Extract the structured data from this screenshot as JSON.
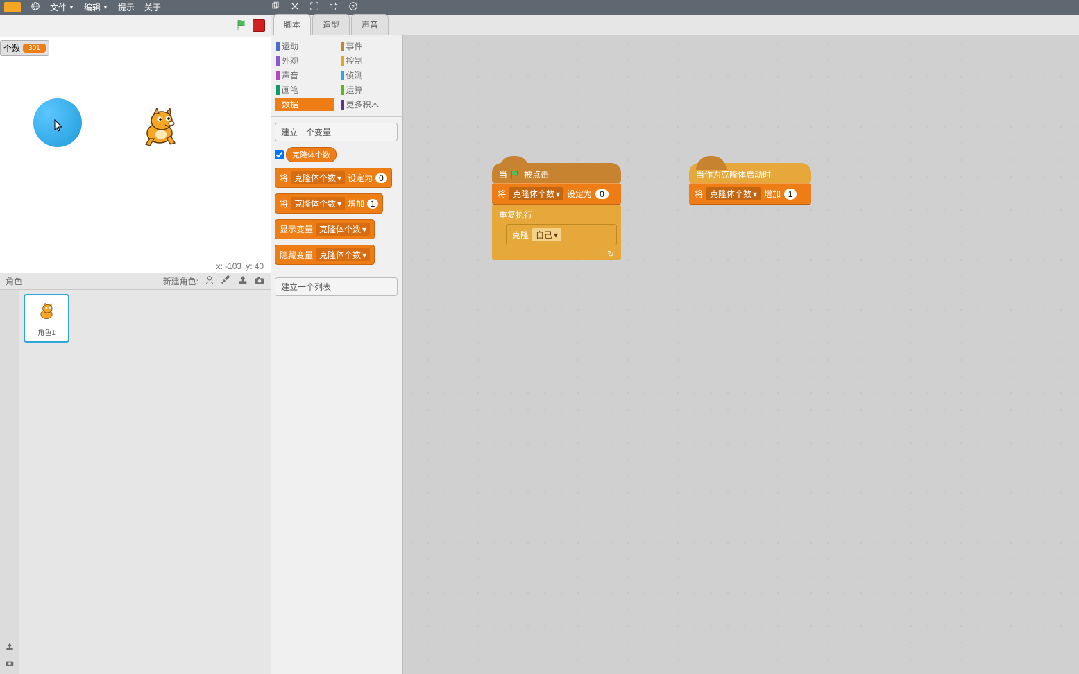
{
  "menu": {
    "file": "文件",
    "edit": "编辑",
    "tips": "提示",
    "about": "关于"
  },
  "stage": {
    "var_name": "个数",
    "var_value": "301",
    "x_label": "x:",
    "x": "-103",
    "y_label": "y:",
    "y": "40"
  },
  "sprites": {
    "section": "角色",
    "new_label": "新建角色:",
    "sprite1": "角色1"
  },
  "tabs": {
    "scripts": "脚本",
    "costumes": "造型",
    "sounds": "声音"
  },
  "categories": {
    "motion": "运动",
    "looks": "外观",
    "sound": "声音",
    "pen": "画笔",
    "data": "数据",
    "events": "事件",
    "control": "控制",
    "sensing": "侦测",
    "operators": "运算",
    "more": "更多积木"
  },
  "palette": {
    "make_var": "建立一个变量",
    "var_name": "克隆体个数",
    "set_pre": "将",
    "set_post": "设定为",
    "set_val": "0",
    "change_pre": "将",
    "change_post": "增加",
    "change_val": "1",
    "show": "显示变量",
    "hide": "隐藏变量",
    "make_list": "建立一个列表"
  },
  "scripts": {
    "when_clicked_pre": "当",
    "when_clicked_post": "被点击",
    "set_pre": "将",
    "set_var": "克隆体个数",
    "set_post": "设定为",
    "set_val": "0",
    "forever": "重复执行",
    "clone_pre": "克隆",
    "clone_target": "自己",
    "when_clone": "当作为克隆体启动时",
    "change_pre": "将",
    "change_var": "克隆体个数",
    "change_post": "增加",
    "change_val": "1"
  }
}
